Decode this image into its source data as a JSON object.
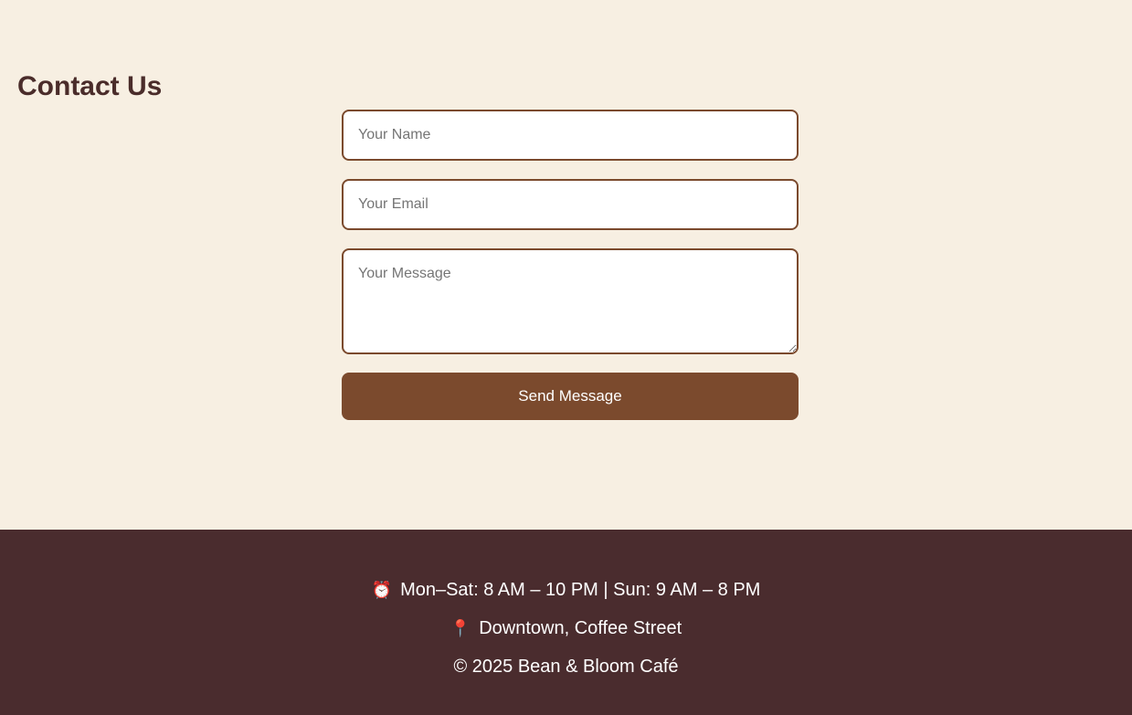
{
  "contact": {
    "title": "Contact Us",
    "name_placeholder": "Your Name",
    "email_placeholder": "Your Email",
    "message_placeholder": "Your Message",
    "send_label": "Send Message"
  },
  "footer": {
    "hours_icon": "⏰",
    "hours_text": "Mon–Sat: 8 AM – 10 PM | Sun: 9 AM – 8 PM",
    "location_icon": "📍",
    "location_text": "Downtown, Coffee Street",
    "copyright": "© 2025 Bean & Bloom Café"
  },
  "colors": {
    "background": "#f7efe2",
    "accent_brown": "#7b4a2d",
    "heading": "#4a2c2a",
    "footer_bg": "#4a2c2e"
  }
}
